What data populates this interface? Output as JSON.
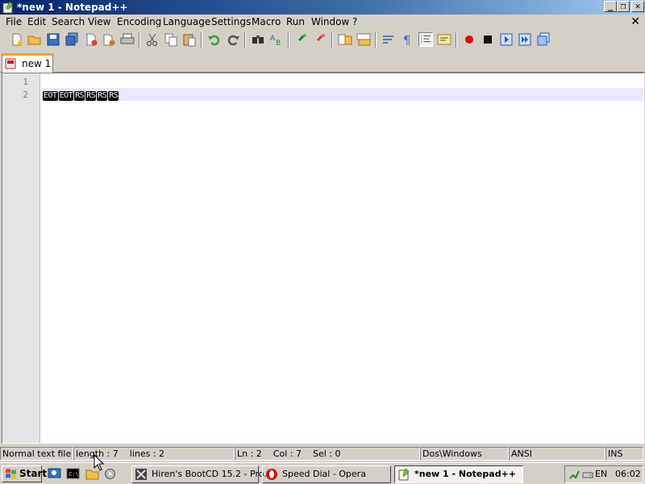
{
  "window": {
    "title": "*new  1 - Notepad++",
    "buttons": {
      "minimize": "_",
      "maximize": "❐",
      "close": "✕"
    }
  },
  "menu": {
    "items": [
      "File",
      "Edit",
      "Search",
      "View",
      "Encoding",
      "Language",
      "Settings",
      "Macro",
      "Run",
      "Window",
      "?"
    ],
    "close_label": "✕"
  },
  "toolbar": {
    "icons": [
      "new-file-icon",
      "open-file-icon",
      "save-icon",
      "save-all-icon",
      "close-icon",
      "close-all-icon",
      "print-icon",
      "cut-icon",
      "copy-icon",
      "paste-icon",
      "undo-icon",
      "redo-icon",
      "find-icon",
      "replace-icon",
      "zoom-in-icon",
      "zoom-out-icon",
      "sync-vertical-icon",
      "sync-horizontal-icon",
      "word-wrap-icon",
      "show-all-chars-icon",
      "indent-guide-icon",
      "user-lang-icon",
      "record-macro-icon",
      "stop-record-icon",
      "playback-macro-icon",
      "run-macro-multiple-icon",
      "save-macro-icon"
    ]
  },
  "tabs": [
    {
      "label": "new  1",
      "active": true
    }
  ],
  "editor": {
    "line_numbers": [
      "1",
      "2"
    ],
    "line2_tokens": [
      "EOT",
      "EOT",
      "RS",
      "RS",
      "RS",
      "RS"
    ],
    "current_line": 2
  },
  "statusbar": {
    "file_type": "Normal text file",
    "length": "length : 7",
    "lines": "lines : 2",
    "ln": "Ln : 2",
    "col": "Col : 7",
    "sel": "Sel : 0",
    "eol": "Dos\\Windows",
    "encoding": "ANSI",
    "mode": "INS"
  },
  "taskbar": {
    "start_label": "Start",
    "tasks": [
      {
        "label": "Hiren's BootCD 15.2 - Pro...",
        "icon": "hbcd-icon",
        "active": false
      },
      {
        "label": "Speed Dial - Opera",
        "icon": "opera-icon",
        "active": false
      },
      {
        "label": "*new  1 - Notepad++",
        "icon": "notepadpp-icon",
        "active": true
      }
    ],
    "tray": {
      "language": "EN",
      "clock": "06:02"
    }
  },
  "colors": {
    "titlebar_start": "#0a246a",
    "titlebar_end": "#a6caf0",
    "current_line_highlight": "#e8e8ff",
    "tab_accent": "#f5a623",
    "control_char_bg": "#000000"
  }
}
